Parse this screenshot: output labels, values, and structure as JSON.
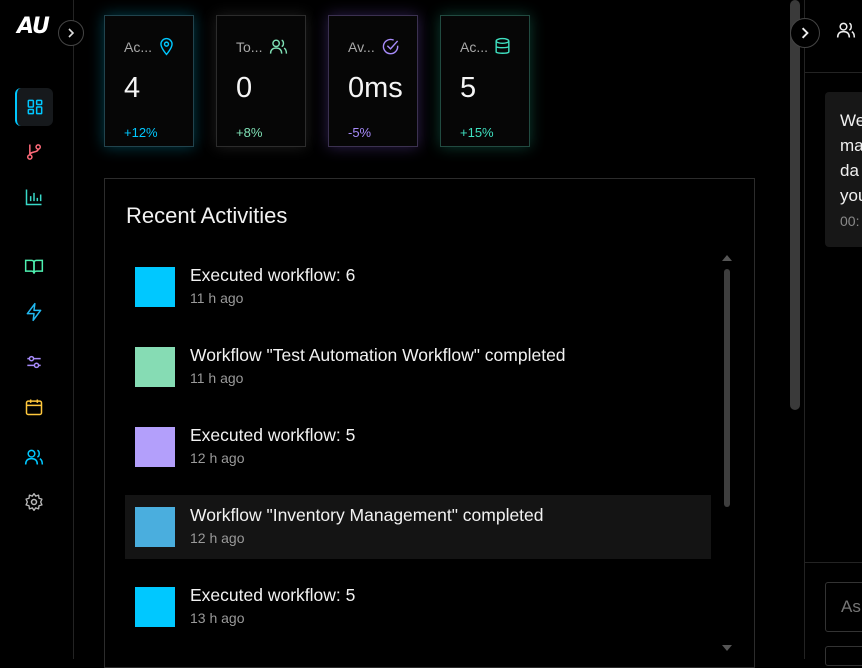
{
  "sidebar": {
    "logo": "AU",
    "items": [
      {
        "icon": "dashboard-icon",
        "color": "#00c8ff",
        "active": true
      },
      {
        "icon": "git-branch-icon",
        "color": "#ff6b7a"
      },
      {
        "icon": "bar-chart-icon",
        "color": "#38d9c8"
      },
      {
        "icon": "book-icon",
        "color": "#4ef0b0"
      },
      {
        "icon": "lightning-icon",
        "color": "#22b8f0"
      },
      {
        "icon": "sliders-icon",
        "color": "#a78bfa"
      },
      {
        "icon": "calendar-icon",
        "color": "#ffc83d"
      },
      {
        "icon": "users-icon",
        "color": "#00c8ff"
      },
      {
        "icon": "gear-icon",
        "color": "#bbbbbb"
      }
    ]
  },
  "stats": [
    {
      "label": "Ac...",
      "value": "4",
      "change": "+12%",
      "icon": "location-pin-icon",
      "color": "#00c8ff"
    },
    {
      "label": "To...",
      "value": "0",
      "change": "+8%",
      "icon": "users-icon",
      "color": "#7fe0b5"
    },
    {
      "label": "Av...",
      "value": "0ms",
      "change": "-5%",
      "icon": "check-circle-icon",
      "color": "#a78bfa"
    },
    {
      "label": "Ac...",
      "value": "5",
      "change": "+15%",
      "icon": "database-icon",
      "color": "#3fe0c0"
    }
  ],
  "activities": {
    "title": "Recent Activities",
    "items": [
      {
        "text": "Executed workflow: 6",
        "time": "11 h ago",
        "color": "#00c8ff"
      },
      {
        "text": "Workflow \"Test Automation Workflow\" completed",
        "time": "11 h ago",
        "color": "#86dcb4"
      },
      {
        "text": "Executed workflow: 5",
        "time": "12 h ago",
        "color": "#b39ffb"
      },
      {
        "text": "Workflow \"Inventory Management\" completed",
        "time": "12 h ago",
        "color": "#4aaede",
        "highlighted": true
      },
      {
        "text": "Executed workflow: 5",
        "time": "13 h ago",
        "color": "#00c8ff"
      }
    ]
  },
  "chat": {
    "message": "We\nma\nda\nyou",
    "time": "00:",
    "input_placeholder": "As"
  }
}
